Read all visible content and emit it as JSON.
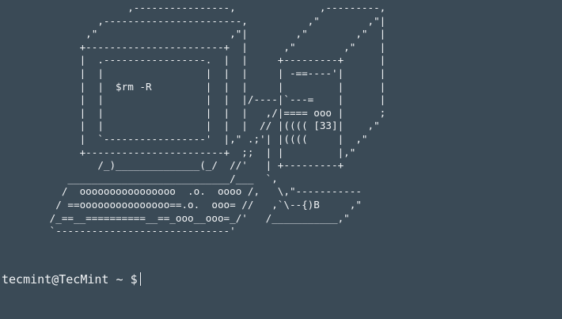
{
  "terminal": {
    "background_color": "#3a4a56",
    "text_color": "#f2f4f6",
    "ascii_art": "                     ,----------------,              ,---------,\n                ,-----------------------,          ,\"        ,\"|\n              ,\"                      ,\"|        ,\"        ,\"  |\n             +-----------------------+  |      ,\"        ,\"    |\n             |  .-----------------.  |  |     +---------+      |\n             |  |                 |  |  |     | -==----'|      |\n             |  |  $rm -R         |  |  |     |         |      |\n             |  |                 |  |  |/----|`---=    |      |\n             |  |                 |  |  |   ,/|==== ooo |      ;\n             |  |                 |  |  |  // |(((( [33]|    ,\"\n             |  `-----------------'  |,\" .;'| |((((     |  ,\"\n             +-----------------------+  ;;  | |         |,\"\n                /_)______________(_/  //'   | +---------+\n           ___________________________/___  `,\n          /  oooooooooooooooo  .o.  oooo /,   \\,\"-----------\n         / ==ooooooooooooooo==.o.  ooo= //   ,`\\--{)B     ,\"\n        /_==__==========__==_ooo__ooo=_/'   /___________,\"\n        `-----------------------------'",
    "prompt": {
      "user_host": "tecmint@TecMint",
      "path": "~",
      "symbol": "$"
    }
  }
}
